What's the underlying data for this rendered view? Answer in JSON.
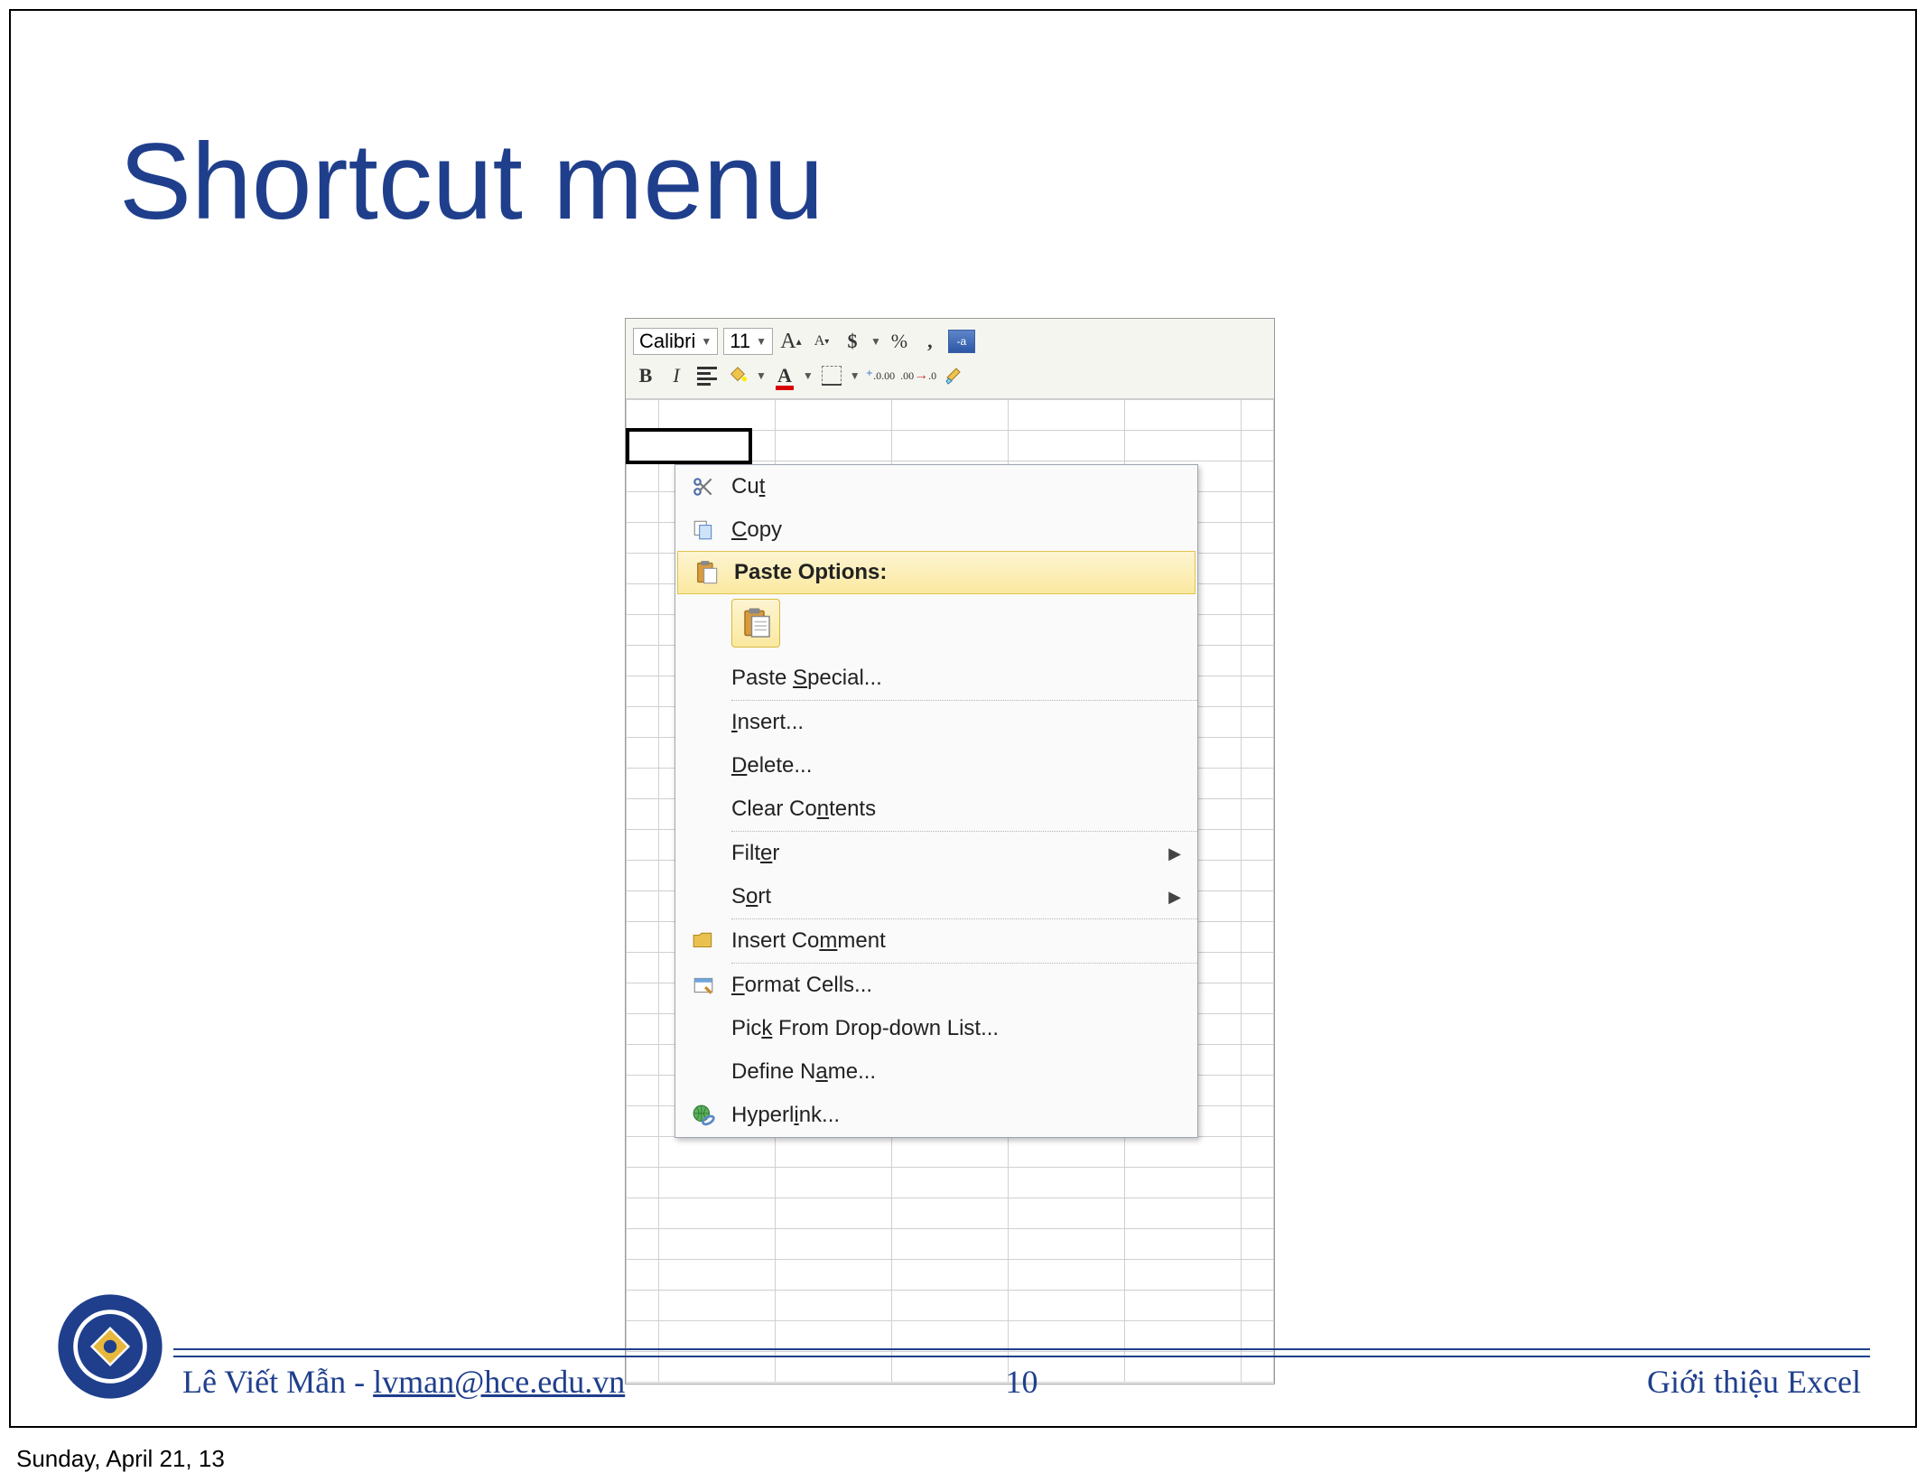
{
  "slide": {
    "title": "Shortcut menu"
  },
  "mini_toolbar": {
    "font_name": "Calibri",
    "font_size": "11",
    "dollar": "$",
    "percent": "%",
    "comma": ",",
    "bold": "B",
    "italic": "I",
    "grow_font": "A",
    "shrink_font": "A",
    "fill_color_letter": "A",
    "font_color_letter": "A",
    "inc_dec": ".0",
    "dec_dec": ".00"
  },
  "context_menu": {
    "cut": "Cut",
    "copy": "Copy",
    "paste_options": "Paste Options:",
    "paste_special": "Paste Special...",
    "insert": "Insert...",
    "delete": "Delete...",
    "clear_contents": "Clear Contents",
    "filter": "Filter",
    "sort": "Sort",
    "insert_comment": "Insert Comment",
    "format_cells": "Format Cells...",
    "pick_list": "Pick From Drop-down List...",
    "define_name": "Define Name...",
    "hyperlink": "Hyperlink..."
  },
  "footer": {
    "author": "Lê Viết Mẫn - ",
    "email": "lvman@hce.edu.vn",
    "page": "10",
    "topic": "Giới thiệu Excel"
  },
  "date_stamp": "Sunday, April 21, 13"
}
